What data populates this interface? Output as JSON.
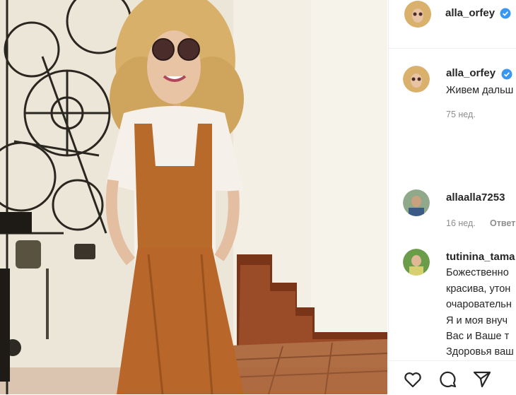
{
  "post": {
    "author": {
      "username": "alla_orfey",
      "verified": true
    },
    "caption": {
      "username": "alla_orfey",
      "text": "Живем дальш",
      "time": "75 нед."
    },
    "comments": [
      {
        "username": "allaalla7253",
        "lines": [],
        "time": "16 нед.",
        "reply": "Ответ"
      },
      {
        "username": "tutinina_tama",
        "lines": [
          "Божественно",
          "красива, утон",
          "очаровательн",
          "Я и моя внуч",
          "Вас и Ваше т",
          "Здоровья ваш"
        ]
      }
    ],
    "actions": [
      "heart-icon",
      "comment-icon",
      "share-icon"
    ]
  }
}
